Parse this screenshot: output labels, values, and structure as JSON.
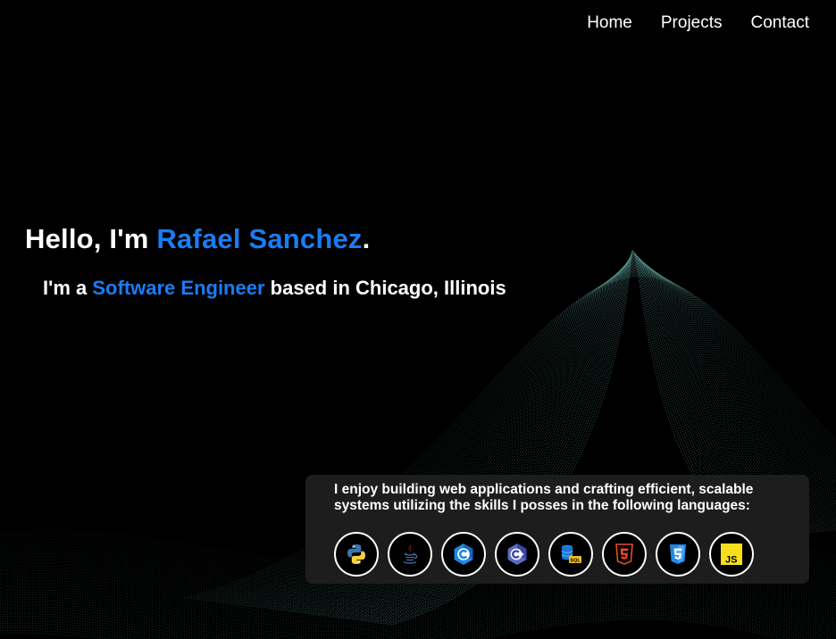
{
  "nav": {
    "items": [
      {
        "label": "Home"
      },
      {
        "label": "Projects"
      },
      {
        "label": "Contact"
      }
    ]
  },
  "hero": {
    "greeting": "Hello, I'm ",
    "name": "Rafael Sanchez",
    "period": ".",
    "sub_prefix": "I'm a ",
    "role": "Software Engineer",
    "sub_suffix": " based in Chicago, Illinois"
  },
  "skills": {
    "text": "I enjoy building web applications and crafting efficient, scalable systems utilizing the skills I posses in the following languages:",
    "icons": [
      "python-icon",
      "java-icon",
      "c-icon",
      "cplusplus-icon",
      "sql-icon",
      "html5-icon",
      "css3-icon",
      "javascript-icon"
    ]
  },
  "colors": {
    "background": "#000000",
    "accent": "#1a7cf5",
    "card": "#1d1d1d",
    "wave": "#6fb8b3"
  }
}
